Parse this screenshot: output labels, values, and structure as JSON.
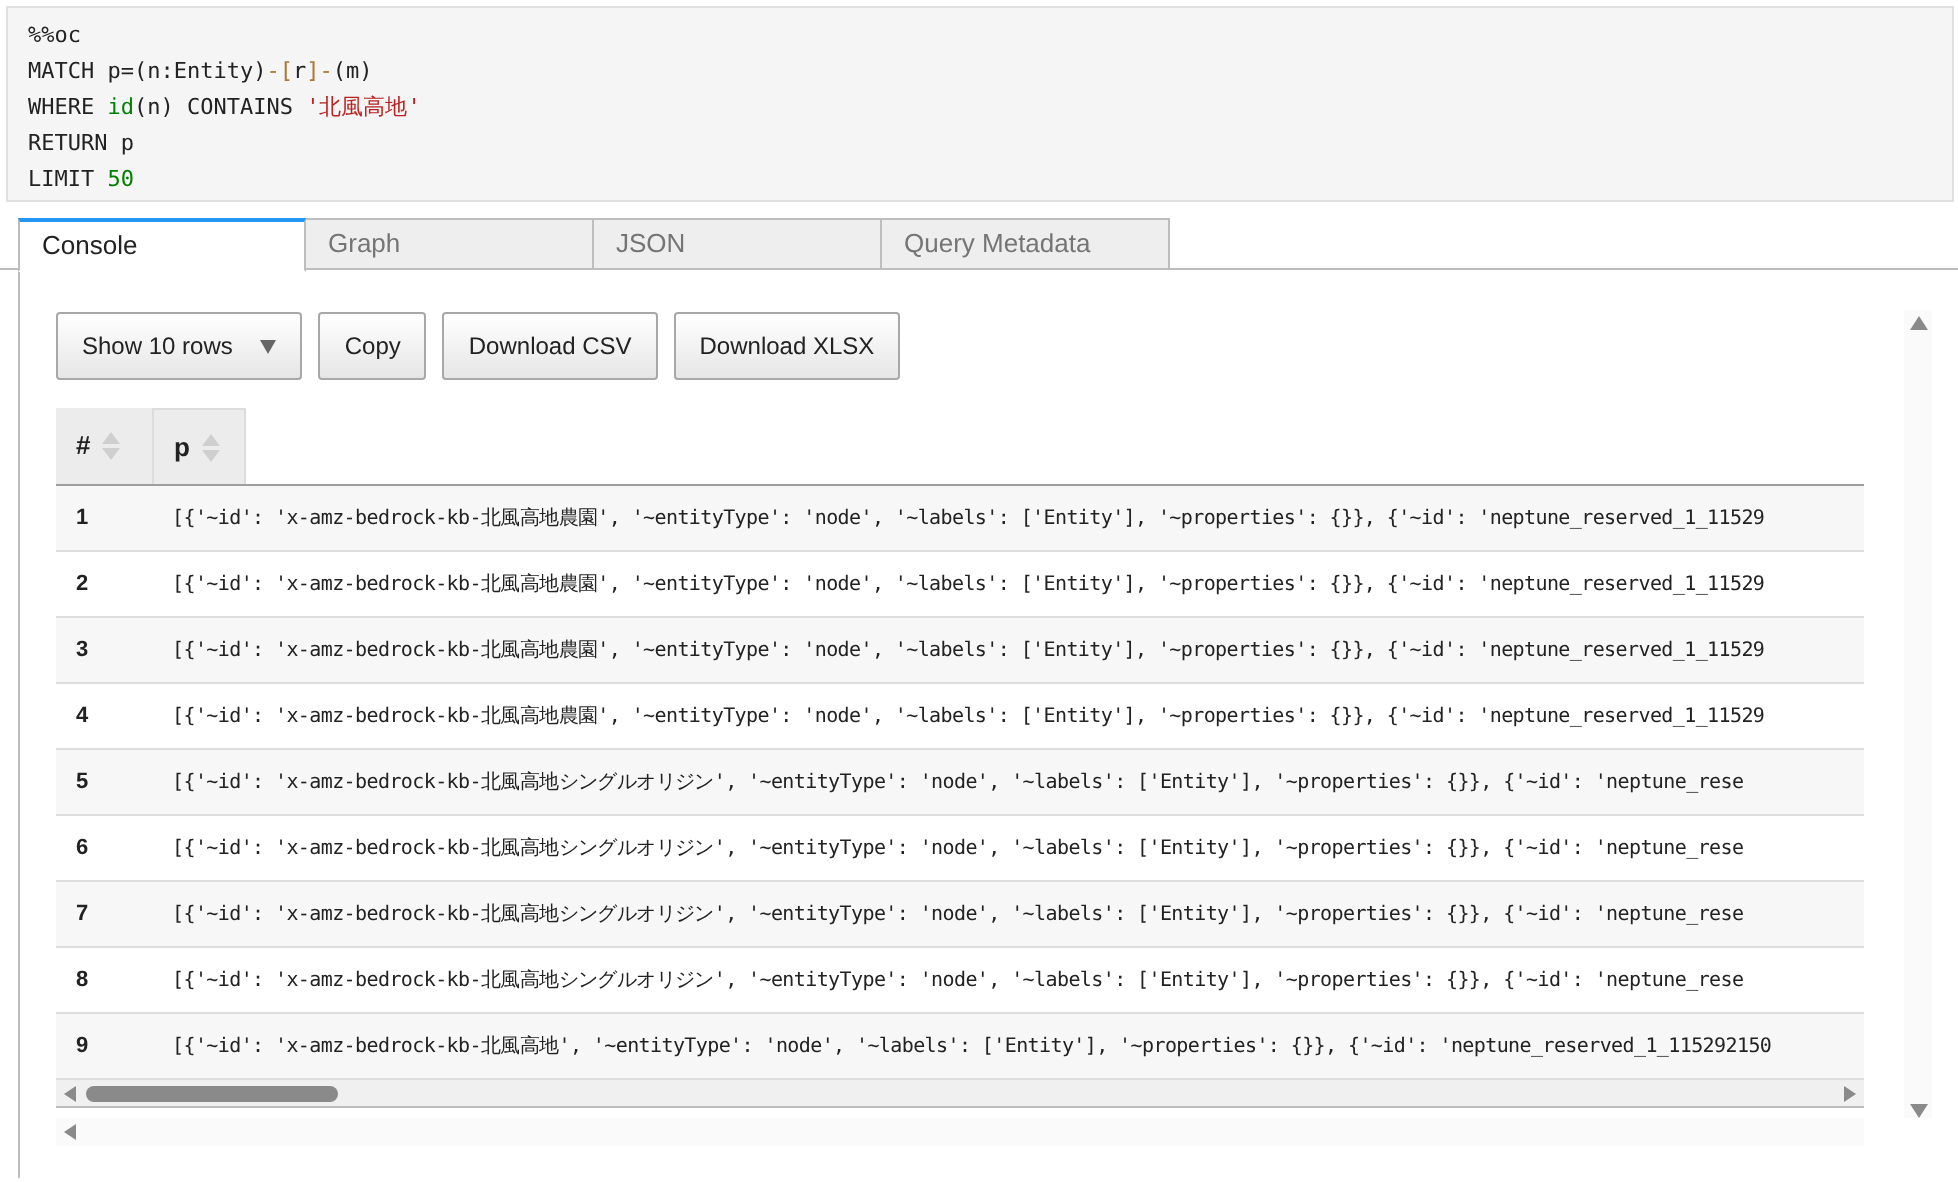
{
  "code_cell": {
    "lines": [
      [
        {
          "text": "%%oc",
          "kind": "plain"
        }
      ],
      [
        {
          "text": "MATCH p=(n:Entity)",
          "kind": "plain"
        },
        {
          "text": "-[",
          "kind": "bracket"
        },
        {
          "text": "r",
          "kind": "plain"
        },
        {
          "text": "]-",
          "kind": "bracket"
        },
        {
          "text": "(m)",
          "kind": "plain"
        }
      ],
      [
        {
          "text": "WHERE ",
          "kind": "plain"
        },
        {
          "text": "id",
          "kind": "builtin"
        },
        {
          "text": "(n) CONTAINS ",
          "kind": "plain"
        },
        {
          "text": "'北風高地'",
          "kind": "string"
        }
      ],
      [
        {
          "text": "RETURN p",
          "kind": "plain"
        }
      ],
      [
        {
          "text": "LIMIT ",
          "kind": "plain"
        },
        {
          "text": "50",
          "kind": "number"
        }
      ]
    ]
  },
  "tabs": [
    {
      "label": "Console",
      "selected": true
    },
    {
      "label": "Graph",
      "selected": false
    },
    {
      "label": "JSON",
      "selected": false
    },
    {
      "label": "Query Metadata",
      "selected": false
    }
  ],
  "buttons": [
    {
      "label": "Show 10 rows",
      "kind": "dropdown"
    },
    {
      "label": "Copy",
      "kind": "button"
    },
    {
      "label": "Download CSV",
      "kind": "button"
    },
    {
      "label": "Download XLSX",
      "kind": "button"
    }
  ],
  "table": {
    "columns": [
      "#",
      "p"
    ],
    "rows": [
      {
        "index": "1",
        "p": "[{'~id': 'x-amz-bedrock-kb-北風高地農園', '~entityType': 'node', '~labels': ['Entity'], '~properties': {}}, {'~id': 'neptune_reserved_1_11529"
      },
      {
        "index": "2",
        "p": "[{'~id': 'x-amz-bedrock-kb-北風高地農園', '~entityType': 'node', '~labels': ['Entity'], '~properties': {}}, {'~id': 'neptune_reserved_1_11529"
      },
      {
        "index": "3",
        "p": "[{'~id': 'x-amz-bedrock-kb-北風高地農園', '~entityType': 'node', '~labels': ['Entity'], '~properties': {}}, {'~id': 'neptune_reserved_1_11529"
      },
      {
        "index": "4",
        "p": "[{'~id': 'x-amz-bedrock-kb-北風高地農園', '~entityType': 'node', '~labels': ['Entity'], '~properties': {}}, {'~id': 'neptune_reserved_1_11529"
      },
      {
        "index": "5",
        "p": "[{'~id': 'x-amz-bedrock-kb-北風高地シングルオリジン', '~entityType': 'node', '~labels': ['Entity'], '~properties': {}}, {'~id': 'neptune_rese"
      },
      {
        "index": "6",
        "p": "[{'~id': 'x-amz-bedrock-kb-北風高地シングルオリジン', '~entityType': 'node', '~labels': ['Entity'], '~properties': {}}, {'~id': 'neptune_rese"
      },
      {
        "index": "7",
        "p": "[{'~id': 'x-amz-bedrock-kb-北風高地シングルオリジン', '~entityType': 'node', '~labels': ['Entity'], '~properties': {}}, {'~id': 'neptune_rese"
      },
      {
        "index": "8",
        "p": "[{'~id': 'x-amz-bedrock-kb-北風高地シングルオリジン', '~entityType': 'node', '~labels': ['Entity'], '~properties': {}}, {'~id': 'neptune_rese"
      },
      {
        "index": "9",
        "p": "[{'~id': 'x-amz-bedrock-kb-北風高地', '~entityType': 'node', '~labels': ['Entity'], '~properties': {}}, {'~id': 'neptune_reserved_1_115292150"
      }
    ]
  }
}
